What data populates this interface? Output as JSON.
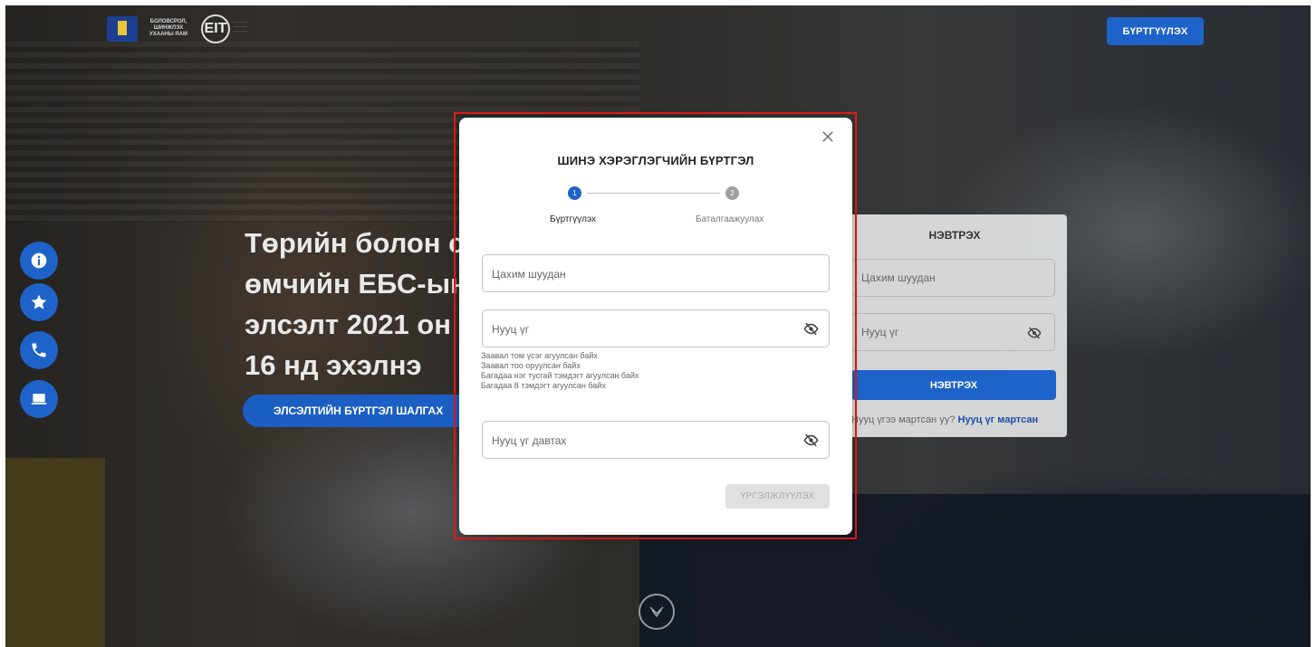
{
  "header": {
    "ministry_logo_text": "БОЛОВСРОЛ, ШИНЖЛЭХ УХААНЫ ЯАМ",
    "eit_logo_text": "EIT",
    "register_button": "БҮРТГҮҮЛЭХ"
  },
  "hero": {
    "title_lines": [
      "Төрийн болон с",
      "өмчийн ЕБС-ын",
      "элсэлт 2021 он",
      "16 нд эхэлнэ"
    ],
    "cta_button": "ЭЛСЭЛТИЙН БҮРТГЭЛ ШАЛГАХ"
  },
  "side_icons": [
    "info-icon",
    "star-icon",
    "phone-icon",
    "laptop-icon"
  ],
  "login_card": {
    "title": "НЭВТРЭХ",
    "email_placeholder": "Цахим шуудан",
    "password_placeholder": "Нууц үг",
    "login_button": "НЭВТРЭХ",
    "forgot_prefix": "Нууц үгээ мартсан уу?",
    "forgot_link": "Нууц үг мартсан"
  },
  "modal": {
    "title": "ШИНЭ ХЭРЭГЛЭГЧИЙН БҮРТГЭЛ",
    "steps": [
      {
        "number": "1",
        "label": "Бүртгүүлэх",
        "active": true
      },
      {
        "number": "2",
        "label": "Баталгаажуулах",
        "active": false
      }
    ],
    "email_placeholder": "Цахим шуудан",
    "password_placeholder": "Нууц үг",
    "password_hints": [
      "Заавал том үсэг агуулсан байх",
      "Заавал тоо оруулсан байх",
      "Багадаа нэг тусгай тэмдэгт агуулсан байх",
      "Багадаа 8 тэмдэгт агуулсан байх"
    ],
    "confirm_password_placeholder": "Нууц үг давтах",
    "continue_button": "ҮРГЭЛЖЛҮҮЛЭХ"
  },
  "colors": {
    "primary": "#1e63c9",
    "highlight_border": "#e01b1b",
    "disabled_button": "#e0e0e0"
  }
}
